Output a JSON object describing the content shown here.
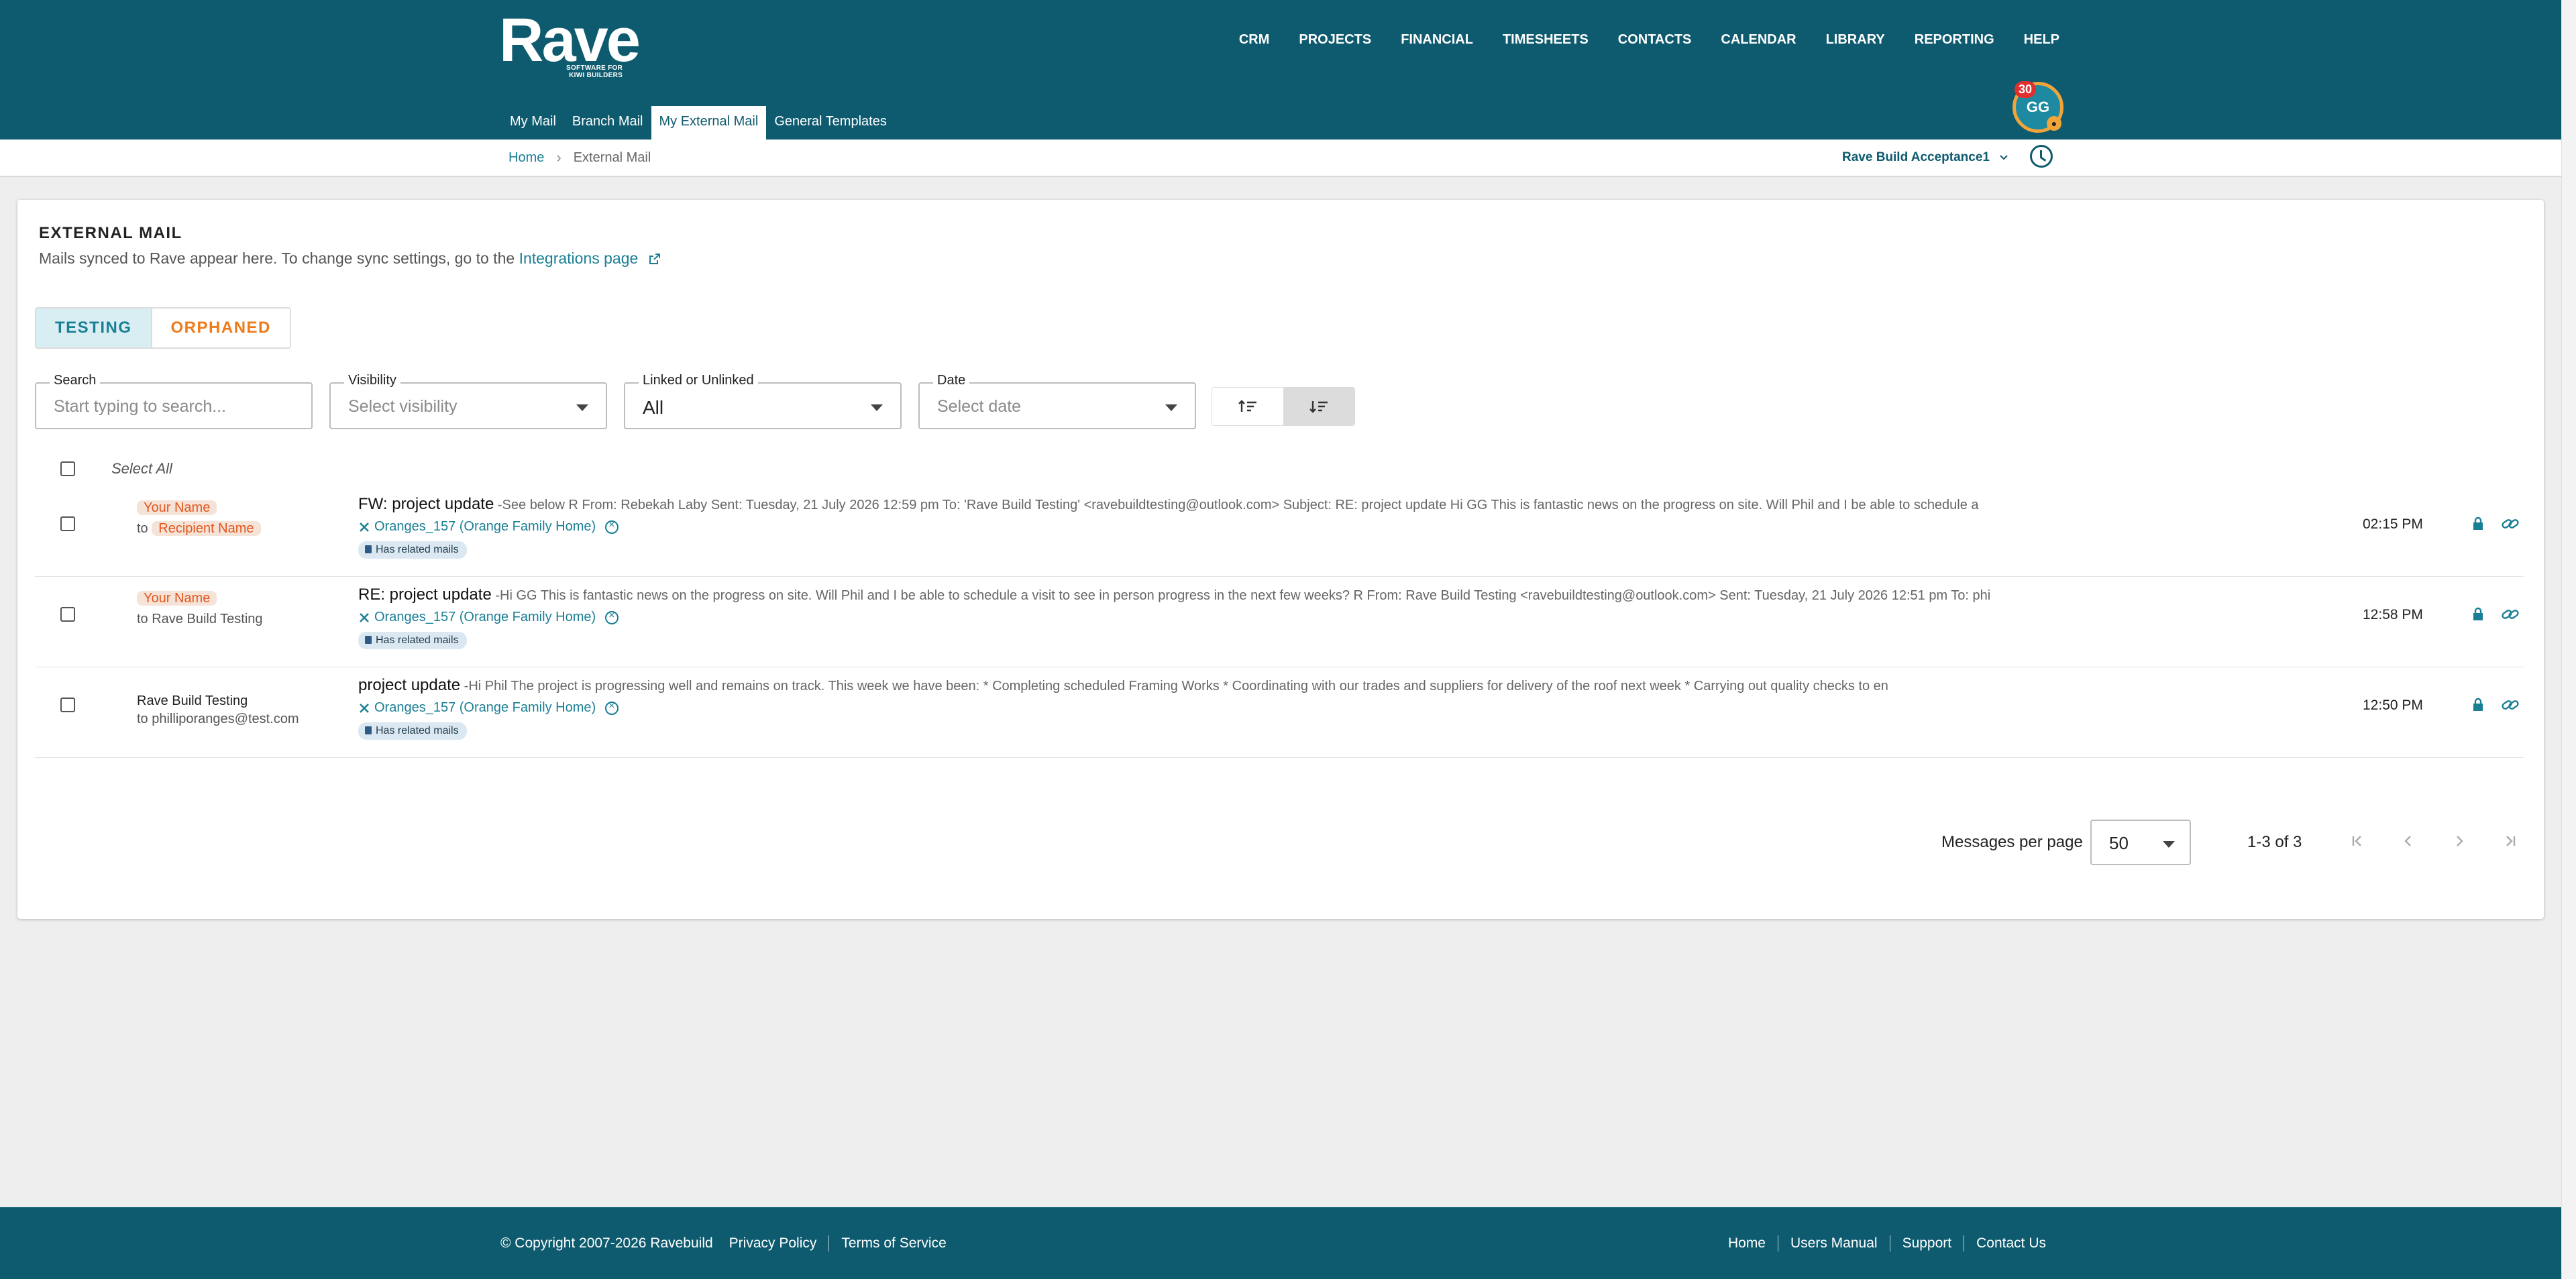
{
  "header": {
    "logo": {
      "word": "Rave",
      "tagline_1": "SOFTWARE FOR",
      "tagline_2": "KIWI BUILDERS"
    },
    "main_nav": [
      "CRM",
      "PROJECTS",
      "FINANCIAL",
      "TIMESHEETS",
      "CONTACTS",
      "CALENDAR",
      "LIBRARY",
      "REPORTING",
      "HELP"
    ],
    "sub_nav": [
      {
        "label": "My Mail",
        "active": false
      },
      {
        "label": "Branch Mail",
        "active": false
      },
      {
        "label": "My External Mail",
        "active": true
      },
      {
        "label": "General Templates",
        "active": false
      }
    ],
    "avatar": {
      "initials": "GG",
      "badge": "30"
    }
  },
  "breadcrumb": {
    "home": "Home",
    "separator": "›",
    "current": "External Mail"
  },
  "account": {
    "name": "Rave Build Acceptance1"
  },
  "page": {
    "title": "EXTERNAL MAIL",
    "subtitle_prefix": "Mails synced to Rave appear here. To change sync settings, go to the ",
    "subtitle_link": "Integrations page"
  },
  "segments": [
    {
      "label": "TESTING",
      "active": true
    },
    {
      "label": "ORPHANED",
      "active": false
    }
  ],
  "filters": {
    "search": {
      "label": "Search",
      "placeholder": "Start typing to search..."
    },
    "visibility": {
      "label": "Visibility",
      "placeholder": "Select visibility"
    },
    "linked": {
      "label": "Linked or Unlinked",
      "value": "All"
    },
    "date": {
      "label": "Date",
      "placeholder": "Select date"
    }
  },
  "sort_buttons": [
    "sort-ascending-icon",
    "sort-descending-icon"
  ],
  "select_all": "Select All",
  "mails": [
    {
      "from": "Your Name",
      "to_prefix": "to",
      "to": "Recipient Name",
      "redacted": true,
      "subject": "FW: project update",
      "preview": " -See below R From: Rebekah Laby Sent: Tuesday, 21 July 2026 12:59 pm To: 'Rave Build Testing' <ravebuildtesting@outlook.com> Subject: RE: project update Hi GG This is fantastic news on the progress on site. Will Phil and I be able to schedule a",
      "project": "Oranges_157 (Orange Family Home)",
      "tag": "Has related mails",
      "time": "02:15 PM"
    },
    {
      "from": "Your Name",
      "to_prefix": "to",
      "to": "to Rave Build Testing",
      "redacted": true,
      "subject": "RE: project update",
      "preview": " -Hi GG This is fantastic news on the progress on site. Will Phil and I be able to schedule a visit to see in person progress in the next few weeks? R From: Rave Build Testing <ravebuildtesting@outlook.com> Sent: Tuesday, 21 July 2026 12:51 pm To: phi",
      "project": "Oranges_157 (Orange Family Home)",
      "tag": "Has related mails",
      "time": "12:58 PM"
    },
    {
      "from": "Rave Build Testing",
      "to_prefix": "to",
      "to": "to philliporanges@test.com",
      "redacted": false,
      "subject": "project update",
      "preview": " -Hi Phil The project is progressing well and remains on track. This week we have been: * Completing scheduled Framing Works * Coordinating with our trades and suppliers for delivery of the roof next week * Carrying out quality checks to en",
      "project": "Oranges_157 (Orange Family Home)",
      "tag": "Has related mails",
      "time": "12:50 PM"
    }
  ],
  "pagination": {
    "label": "Messages per page",
    "per_page": "50",
    "range": "1-3 of 3"
  },
  "footer": {
    "copyright": "© Copyright 2007-2026 Ravebuild",
    "left_links": [
      "Privacy Policy",
      "Terms of Service"
    ],
    "right_links": [
      "Home",
      "Users Manual",
      "Support",
      "Contact Us"
    ]
  },
  "colors": {
    "brand": "#0e5a6e",
    "link": "#1a7f95",
    "orphaned": "#ef7a1a",
    "badge": "#e0302e"
  }
}
